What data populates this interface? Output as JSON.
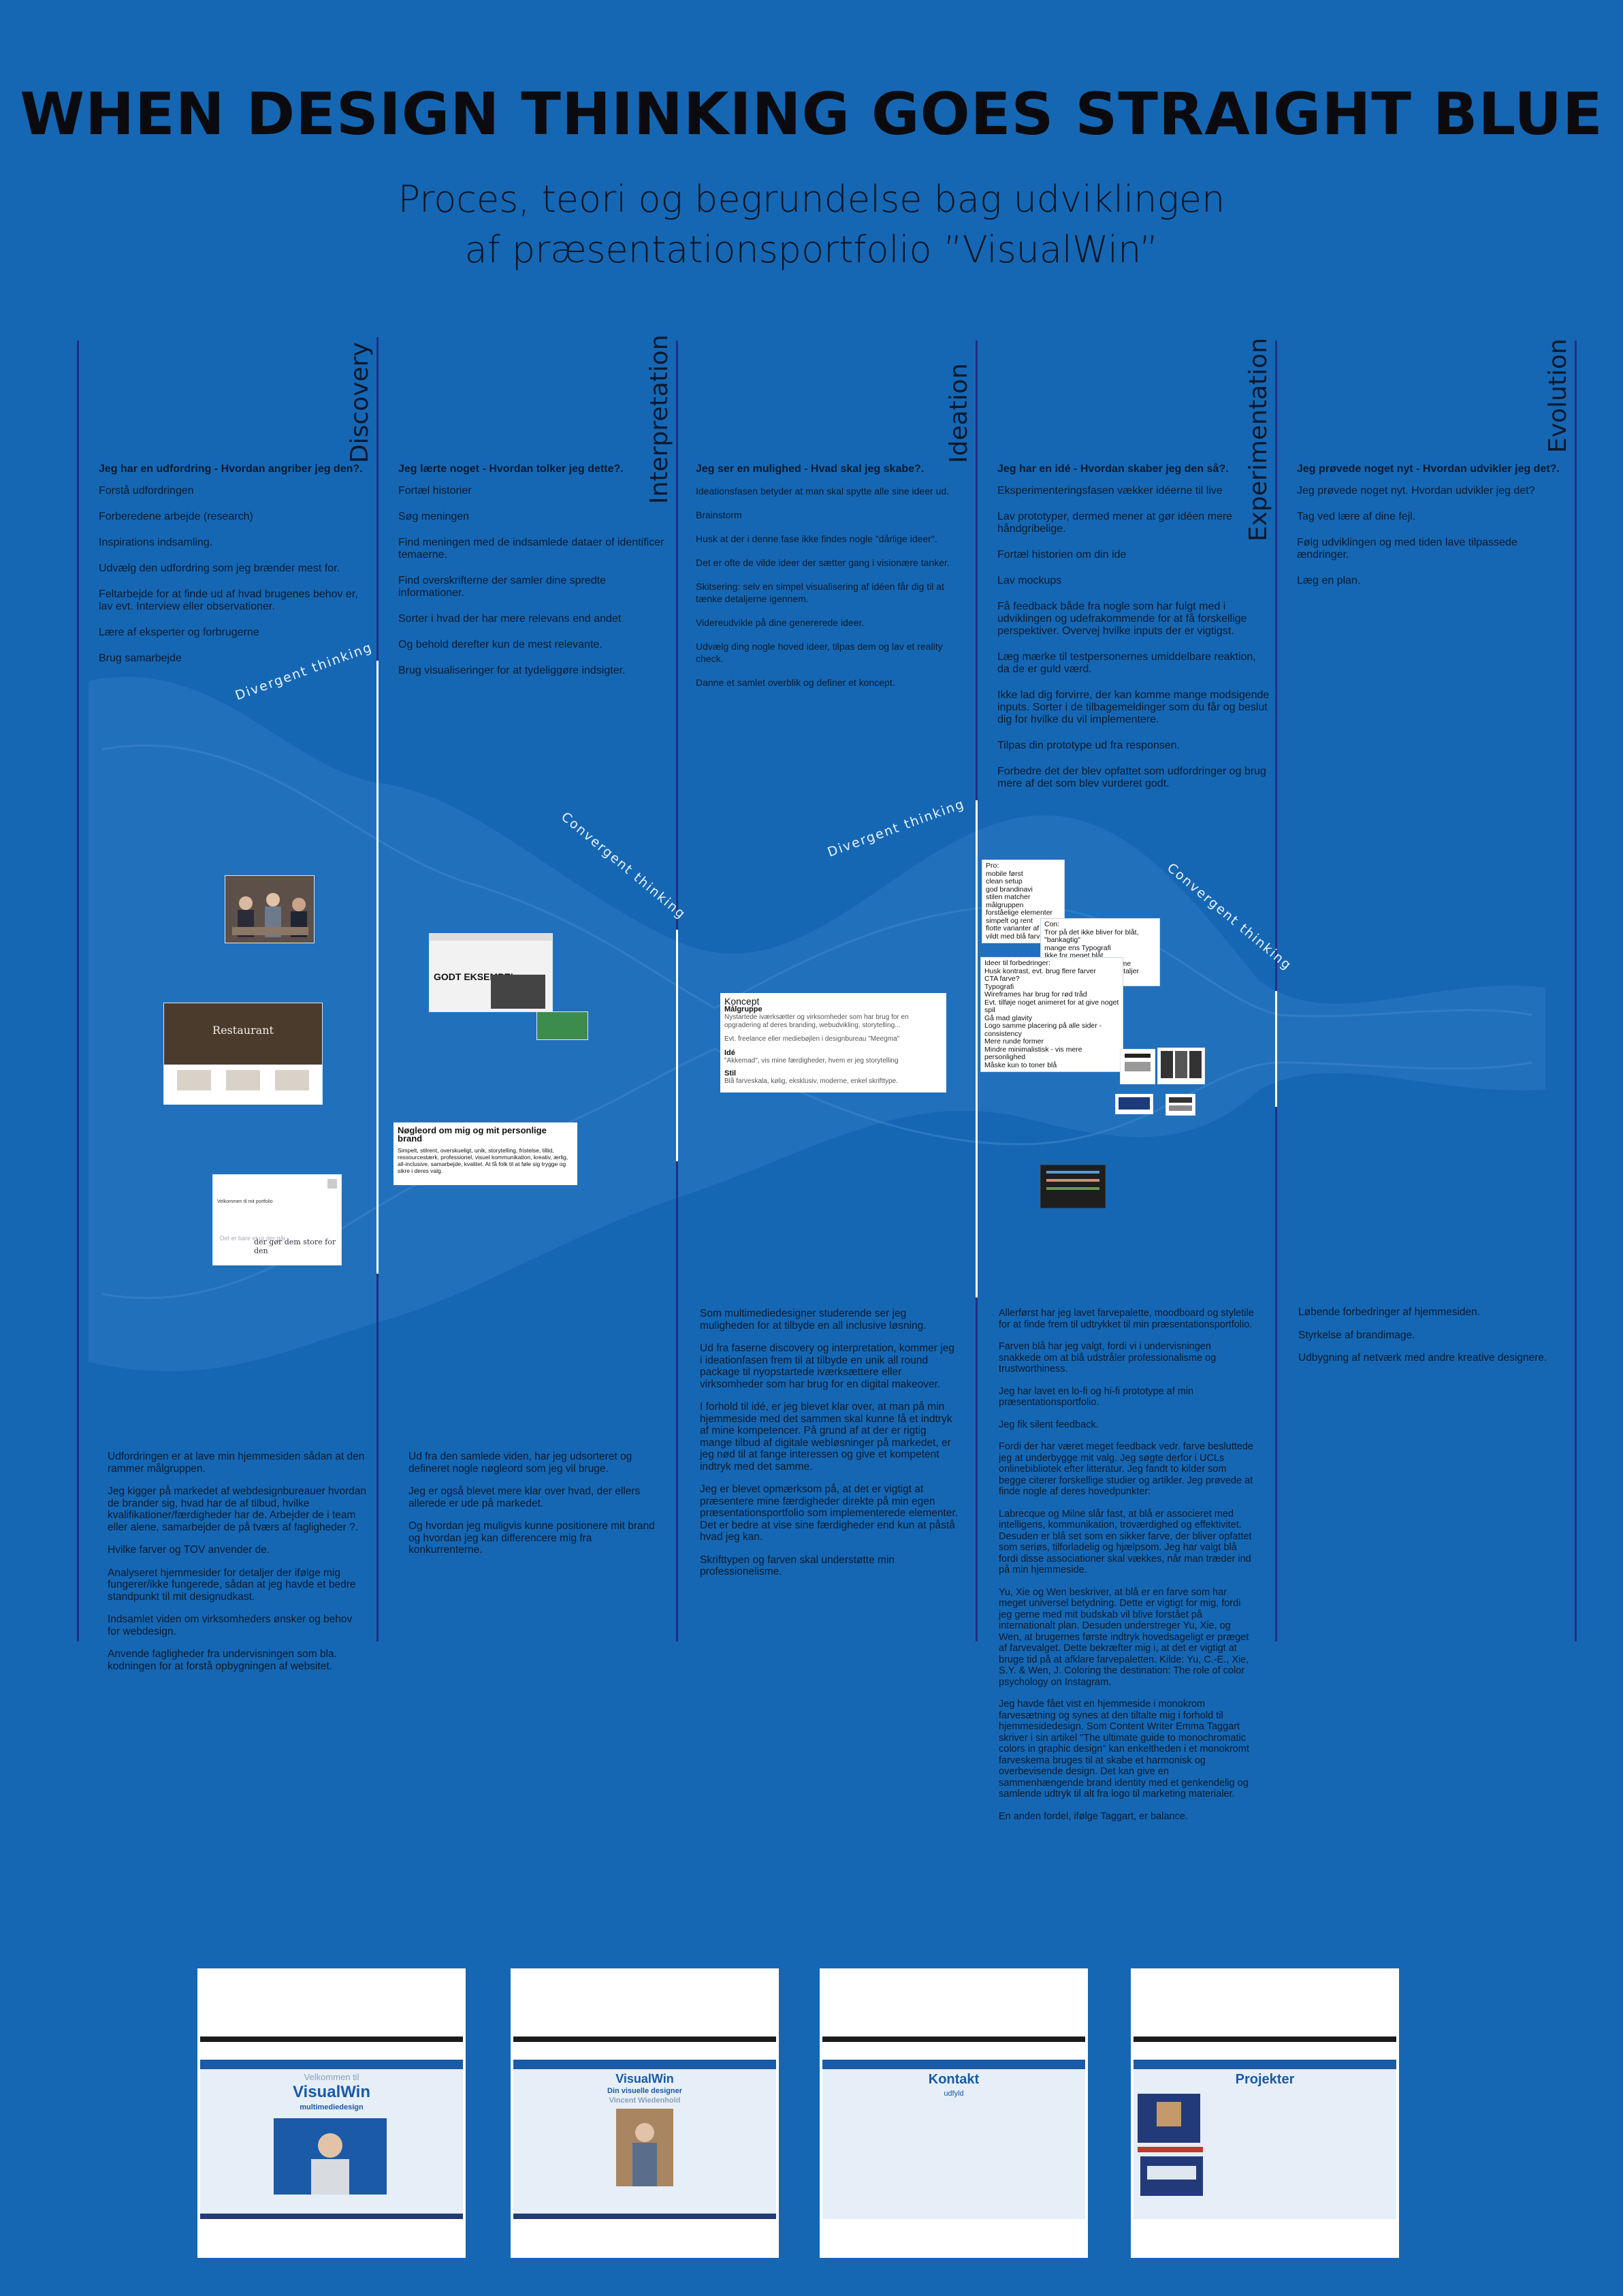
{
  "title": "WHEN DESIGN THINKING GOES STRAIGHT BLUE",
  "subtitle_line1": "Proces, teori og begrundelse bag udviklingen",
  "subtitle_line2": "af præsentationsportfolio ”VisualWin”",
  "stages": [
    "Discovery",
    "Interpretation",
    "Ideation",
    "Experimentation",
    "Evolution"
  ],
  "thinking": {
    "divergent": "Divergent thinking",
    "convergent": "Convergent thinking"
  },
  "columns": [
    {
      "head": "Jeg har en udfordring - Hvordan angriber jeg den?.",
      "items": [
        "Forstå udfordringen",
        "Forberedene arbejde (research)",
        "Inspirations indsamling.",
        "Udvælg den udfordring som jeg brænder mest for.",
        "Feltarbejde for at finde ud af hvad brugenes behov er, lav evt. Interview eller observationer.",
        "Lære af eksperter og forbrugerne",
        "Brug samarbejde"
      ]
    },
    {
      "head": "Jeg lærte noget - Hvordan tolker jeg dette?.",
      "items": [
        "Fortæl historier",
        "Søg meningen",
        "Find meningen med de indsamlede dataer of identificer temaerne.",
        "Find overskrifterne der samler dine spredte informationer.",
        "Sorter i hvad der har mere relevans end andet",
        "Og behold derefter kun de mest relevante.",
        "Brug visualiseringer for at tydeliggøre indsigter."
      ]
    },
    {
      "head": "Jeg ser en mulighed - Hvad skal jeg skabe?.",
      "items": [
        "Ideationsfasen betyder at man skal spytte alle sine ideer ud.",
        "Brainstorm",
        "Husk at der i denne fase ikke findes nogle \"dårlige ideer\".",
        "Det er ofte de vilde ideer der sætter gang i visionære tanker.",
        "Skitsering: selv en simpel visualisering af idéen får dig til at tænke detaljerne igennem.",
        "Videreudvikle på dine genererede ideer.",
        "Udvælg ding nogle hoved ideer, tilpas dem og lav et reality check.",
        "Danne et samlet overblik og definer et koncept."
      ]
    },
    {
      "head": "Jeg har en idé - Hvordan skaber jeg den så?.",
      "items": [
        "Eksperimenteringsfasen vækker idéerne til live",
        "Lav prototyper, dermed mener at gør idéen mere håndgribelige.",
        "Fortæl historien om din ide",
        "Lav mockups",
        "Få feedback både fra nogle som har fulgt med i udviklingen og udefrakommende for at få forskellige perspektiver. Overvej hvilke inputs der er vigtigst.",
        "Læg mærke til testpersonernes umiddelbare reaktion, da de er guld værd.",
        "Ikke lad dig forvirre, der kan komme mange modsigende inputs. Sorter i de tilbagemeldinger som du får og beslut dig for hvilke du vil implementere.",
        "Tilpas din prototype ud fra responsen.",
        "Forbedre det der blev opfattet som udfordringer og brug mere af det som blev vurderet godt."
      ]
    },
    {
      "head": "Jeg prøvede noget nyt - Hvordan udvikler jeg det?.",
      "items": [
        "Jeg prøvede noget nyt. Hvordan udvikler jeg det?",
        "Tag ved lære af dine fejl.",
        "Følg udviklingen og med tiden lave tilpassede ændringer.",
        "Læg en plan."
      ]
    }
  ],
  "cards": {
    "good_example": "GODT EKSEMPEL",
    "brand_title": "Nøgleord om mig og mit personlige brand",
    "brand_text": "Simpelt, stilrent, overskueligt, unik, storytelling, fristelse, tillid, ressourcestærk, professionel, visuel kommunikation, kreativ, ærlig, all-inclusive, samarbejde, kvalitet. At få folk til at føle sig trygge og sikre i deres valg.",
    "concept_title": "Koncept",
    "concept_sub": "Målgruppe",
    "concept_text1": "Nystartede iværksætter og virksomheder som har brug for en opgradering af deres branding, webudvikling, storytelling...",
    "concept_text2": "Evt. freelance eller mediebøjlen i designbureau \"Meegma\"",
    "concept_idea_label": "Idé",
    "concept_idea": "\"Akkemad\", vis mine færdigheder, hvem er jeg storytelling",
    "concept_style_label": "Stil",
    "concept_style": "Blå farveskala, kølig, eksklusiv, moderne, enkel skrifttype.",
    "webshot1": "Velkommen til mit portfolio",
    "webshot2_a": "Det er bare et ur der går",
    "webshot2_b": "der gør dem store for den"
  },
  "notes": [
    [
      "Pro:",
      "mobile først",
      "clean setup",
      "god brandinavi",
      "stilen matcher målgruppen",
      "forståelige elementer",
      "simpelt og rent",
      "flotte varianter af blå",
      "vildt med blå farve"
    ],
    [
      "Con:",
      "Tror på det ikke bliver for blåt, \"bankagtig\"",
      "mange ens Typografi",
      "Ikke for meget blåt",
      "mangler chop på wireframe",
      "indviklet opsætning af detaljer stylesiden"
    ],
    [
      "Ideer til forbedringer:",
      "Husk kontrast, evt. brug flere farver",
      "CTA farve?",
      "Typografi",
      "Wireframes har brug for rød tråd",
      "Evt. tilføje noget animeret for at give noget spil",
      "Gå mad glavity",
      "Logo samme placering på alle sider - consistency",
      "Mere runde former",
      "Mindre minimalistisk - vis mere personlighed",
      "Måske kun to toner blå"
    ]
  ],
  "lower": {
    "discovery": [
      "Udfordringen er at lave min hjemmesiden sådan at den rammer målgruppen.",
      "Jeg kigger på markedet af webdesignbureauer hvordan de brander sig, hvad har de af tilbud, hvilke kvalifikationer/færdigheder har de. Arbejder de i team eller alene, samarbejder de på tværs af fagligheder ?.",
      "Hvilke farver og TOV anvender de.",
      "Analyseret hjemmesider for detaljer der ifølge mig fungerer/ikke fungerede, sådan at jeg havde et bedre standpunkt til mit designudkast.",
      "Indsamlet viden om virksomheders ønsker og behov for webdesign.",
      "Anvende fagligheder fra undervisningen som bla. kodningen for at forstå opbygningen af websitet."
    ],
    "interpretation": [
      "Ud fra den samlede viden, har jeg udsorteret og defineret nogle nøgleord som jeg vil bruge.",
      "Jeg er også blevet mere klar over hvad, der ellers allerede er ude på markedet.",
      "Og hvordan jeg muligvis kunne positionere mit brand og hvordan jeg kan differencere mig fra konkurrenterne."
    ],
    "ideation": [
      "Som multimediedesigner studerende ser jeg muligheden for at tilbyde en all inclusive løsning.",
      "Ud fra faserne discovery og interpretation, kommer jeg i ideationfasen frem til at tilbyde en unik all round package til nyopstartede iværksættere eller virksomheder som har brug for en digital makeover.",
      "I forhold til idé, er jeg blevet klar over, at man på min hjemmeside med det sammen skal kunne få et indtryk af mine kompetencer. På grund af at der er rigtig mange tilbud af digitale webløsninger på markedet, er jeg nød til at fange interessen og give et kompetent indtryk med det samme.",
      "Jeg er blevet opmærksom på, at det er vigtigt at præsentere mine færdigheder direkte på min egen præsentationsportfolio som implementerede elementer. Det er bedre at vise sine færdigheder end kun at påstå hvad jeg kan.",
      "Skrifttypen og farven skal understøtte min professionelisme."
    ],
    "experimentation": [
      "Allerførst har jeg lavet farvepalette, moodboard og styletile for at finde frem til udtrykket til min præsentationsportfolio.",
      "Farven blå har jeg valgt, fordi vi i undervisningen snakkede om at blå udstråler professionalisme og trustworthiness.",
      "Jeg har lavet en lo-fi og hi-fi prototype af min præsentationsportfolio.",
      "Jeg fik silent feedback.",
      "Fordi der har været meget feedback vedr. farve besluttede jeg at underbygge mit valg. Jeg søgte derfor i UCLs onlinebibliotek efter litteratur. Jeg fandt to kilder som begge citerer forskellige studier og artikler. Jeg prøvede at finde nogle af deres hovedpunkter:",
      "Labrecque og Milne slår fast, at blå er associeret med intelligens, kommunikation, troværdighed og effektivitet. Desuden er blå set som en sikker farve, der bliver opfattet som seriøs, tilforladelig og hjælpsom. Jeg har valgt blå fordi disse associationer skal vækkes, når man træder ind på min hjemmeside.",
      "Yu, Xie og Wen beskriver, at blå er en farve som har meget universel betydning. Dette er vigtigt for mig, fordi jeg gerne med mit budskab vil blive forstået på internationalt plan. Desuden understreger Yu, Xie, og Wen, at brugernes første indtryk hovedsageligt er præget af farvevalget. Dette bekræfter mig i, at det er vigtigt at bruge tid på at afklare farvepaletten. Kilde: Yu, C.-E., Xie, S.Y. & Wen, J. Coloring the destination: The role of color psychology on Instagram.",
      "Jeg havde fået vist en hjemmeside i monokrom farvesætning og synes at den tiltalte mig i forhold til hjemmesidedesign. Som Content Writer Emma Taggart skriver i sin artikel \"The ultimate guide to monochromatic colors in graphic design\" kan enkeltheden i et monokromt farveskema bruges til at skabe et harmonisk og overbevisende design. Det kan give en sammenhængende brand identity med et genkendelig og samlende udtryk til alt fra logo til marketing materialer.",
      "En anden fordel, ifølge Taggart, er balance."
    ],
    "evolution": [
      "Løbende forbedringer af hjemmesiden.",
      "Styrkelse af brandimage.",
      "Udbygning af netværk med andre kreative designere."
    ]
  },
  "screenshots": [
    {
      "line1": "Velkommen til",
      "line2": "VisualWin",
      "line3": "multimediedesign"
    },
    {
      "line1": "VisualWin",
      "line2": "Din visuelle designer",
      "line3": "Vincent Wiedenhold"
    },
    {
      "line1": "Kontakt",
      "line2": "udfyld",
      "line3": ""
    },
    {
      "line1": "Projekter",
      "line2": "",
      "line3": ""
    }
  ],
  "colors": {
    "background": "#1567b3",
    "divider": "#1f2f86",
    "flow_shape": "#2b79c2"
  }
}
